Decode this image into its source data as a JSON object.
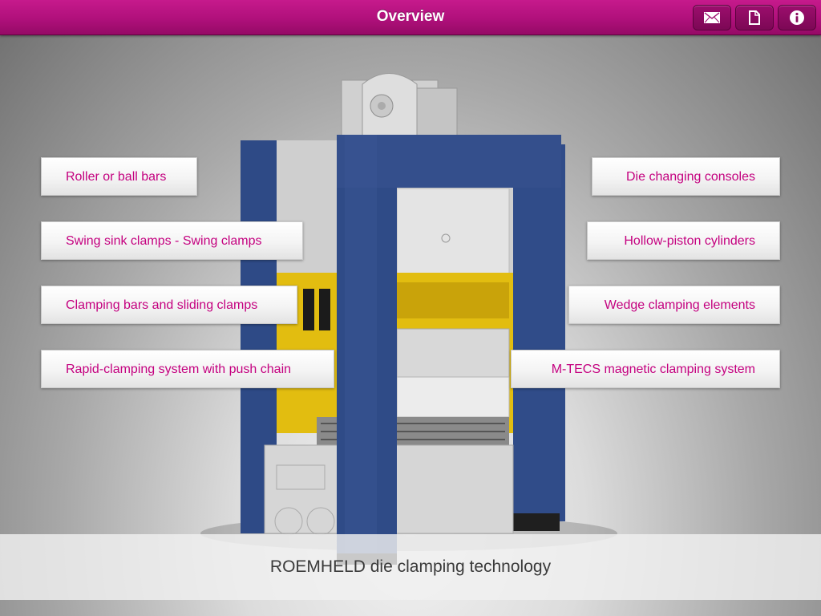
{
  "header": {
    "title": "Overview",
    "accent_color": "#b0107b",
    "buttons": [
      {
        "icon": "mail-icon"
      },
      {
        "icon": "document-icon"
      },
      {
        "icon": "info-icon"
      }
    ]
  },
  "left_options": [
    {
      "label": "Roller or ball bars"
    },
    {
      "label": "Swing sink clamps - Swing clamps"
    },
    {
      "label": "Clamping bars and sliding clamps"
    },
    {
      "label": "Rapid-clamping system with push chain"
    }
  ],
  "right_options": [
    {
      "label": "Die changing consoles"
    },
    {
      "label": "Hollow-piston cylinders"
    },
    {
      "label": "Wedge clamping elements"
    },
    {
      "label": "M-TECS magnetic clamping system"
    }
  ],
  "footer": {
    "caption": "ROEMHELD die clamping technology"
  },
  "colors": {
    "option_text": "#c4007f",
    "press_frame": "#2f4b87",
    "press_yellow": "#e2bd10"
  }
}
